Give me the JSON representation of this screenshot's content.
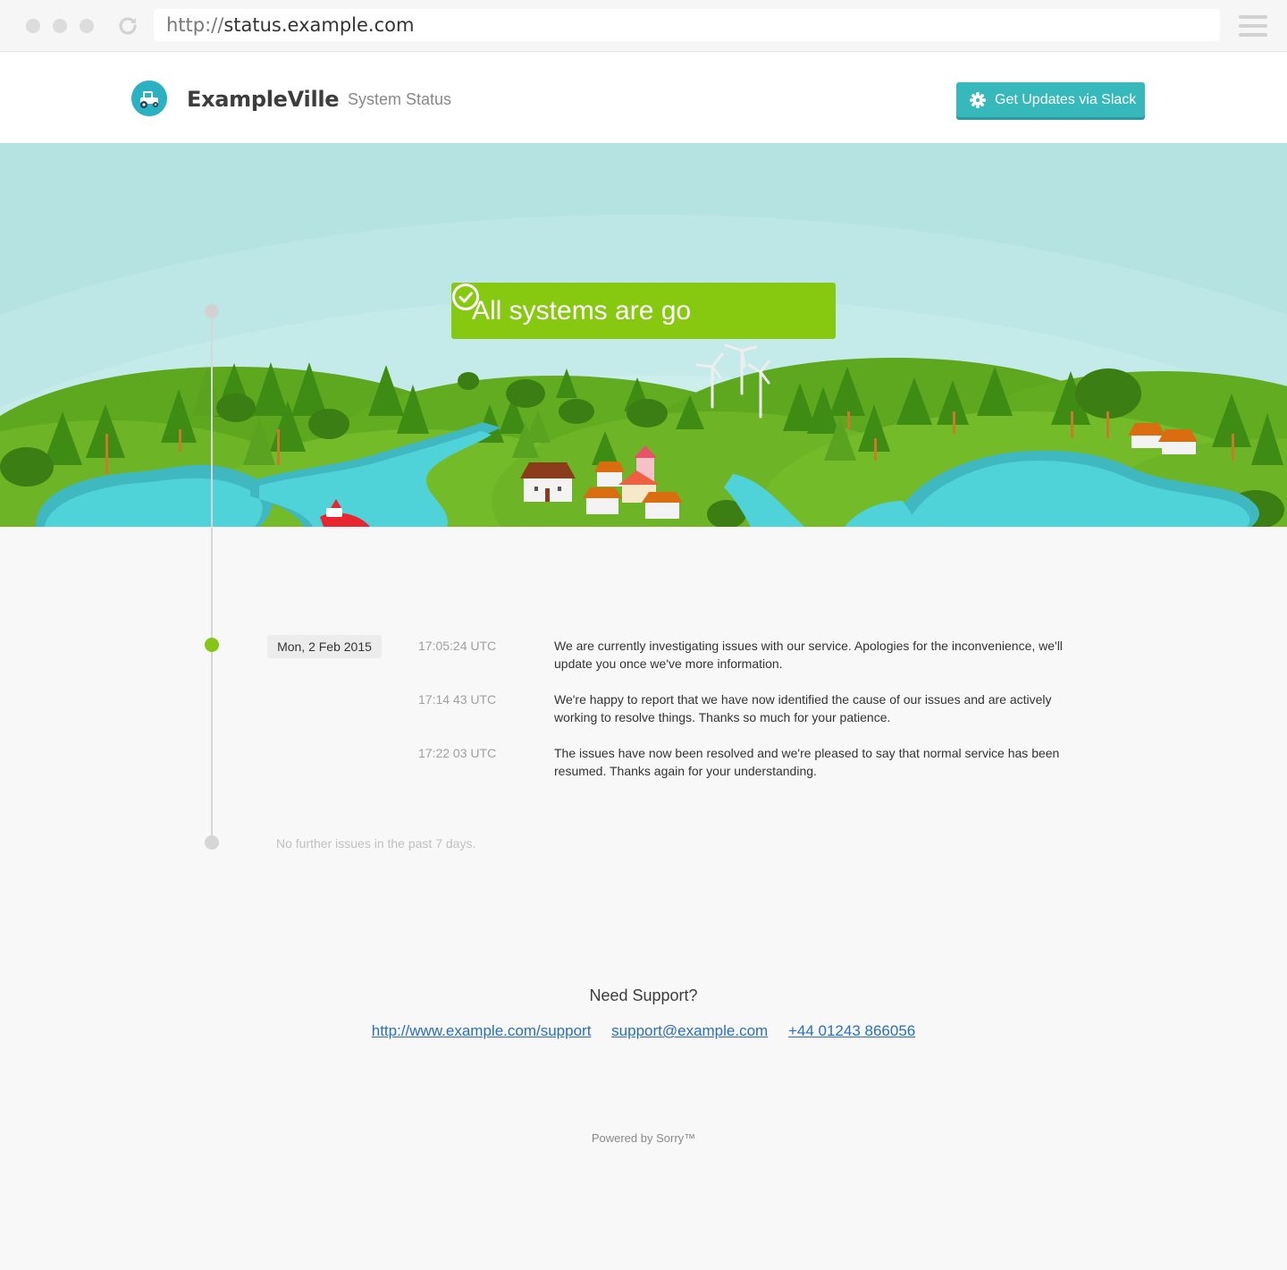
{
  "browser": {
    "url_scheme": "http://",
    "url_host": "status.example.com"
  },
  "header": {
    "brand": "ExampleVille",
    "subtitle": "System Status",
    "slack_button": "Get Updates via Slack"
  },
  "status": {
    "text": "All systems are go",
    "color": "#87c811"
  },
  "incident": {
    "date": "Mon, 2 Feb 2015",
    "updates": [
      {
        "time": "17:05:24 UTC",
        "message": "We are currently investigating issues with our service. Apologies for the inconvenience, we'll update you once we've more information."
      },
      {
        "time": "17:14 43 UTC",
        "message": "We're happy to report that we have now identified the cause of our issues and are actively working to resolve things. Thanks so much for your patience."
      },
      {
        "time": "17:22 03 UTC",
        "message": "The issues have now been resolved and we're pleased to say that normal service has been resumed. Thanks again for your understanding."
      }
    ],
    "footer_note": "No further issues in the past 7 days."
  },
  "support": {
    "title": "Need Support?",
    "links": [
      "http://www.example.com/support",
      "support@example.com",
      "+44 01243 866056"
    ]
  },
  "powered_by": "Powered by Sorry™",
  "colors": {
    "accent_teal": "#37b8bb",
    "status_green": "#87c811",
    "link_blue": "#2a6ebf"
  }
}
